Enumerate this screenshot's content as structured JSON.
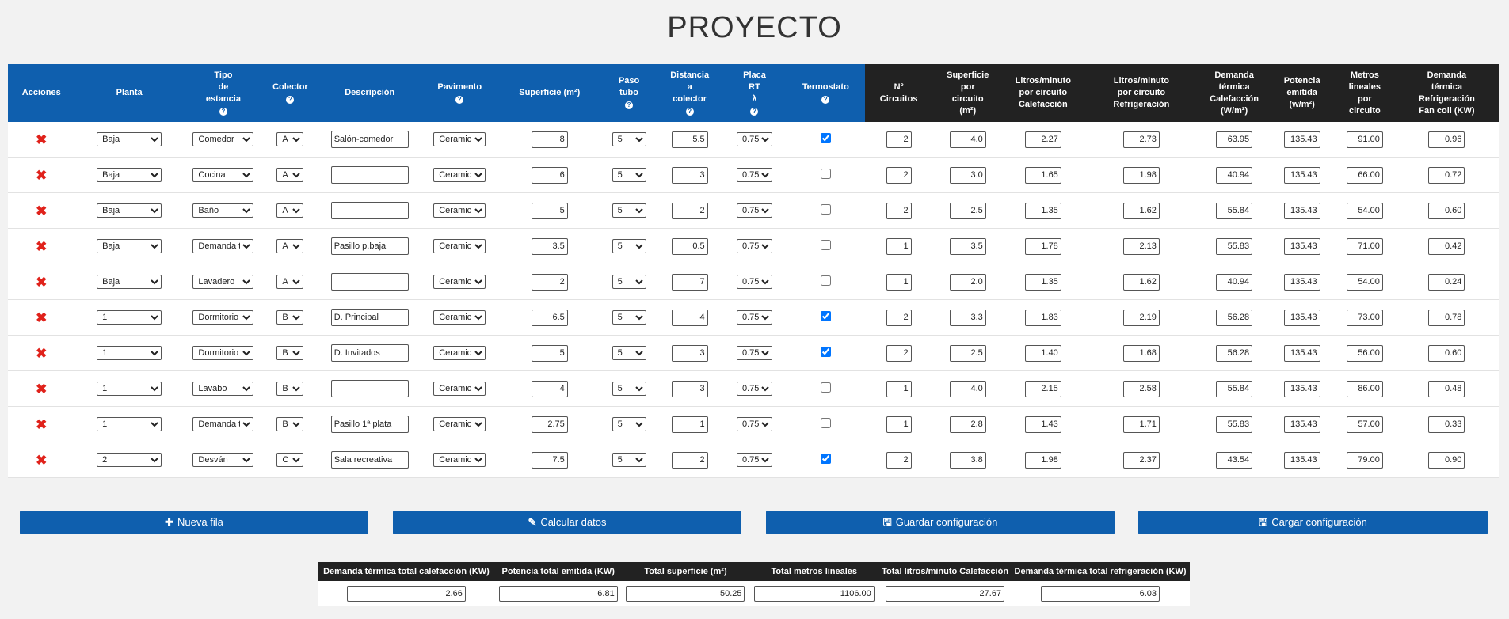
{
  "page_title": "PROYECTO",
  "headers": {
    "acciones": "Acciones",
    "planta": "Planta",
    "tipo_1": "Tipo",
    "tipo_2": "de",
    "tipo_3": "estancia",
    "colector": "Colector",
    "descripcion": "Descripción",
    "pavimento": "Pavimento",
    "superficie": "Superficie (m²)",
    "paso_1": "Paso",
    "paso_2": "tubo",
    "dist_1": "Distancia",
    "dist_2": "a",
    "dist_3": "colector",
    "placa_1": "Placa",
    "placa_2": "RT",
    "placa_3": "λ",
    "termostato": "Termostato",
    "nc_1": "Nº",
    "nc_2": "Circuitos",
    "spc_1": "Superficie",
    "spc_2": "por",
    "spc_3": "circuito",
    "spc_4": "(m²)",
    "lc_1": "Litros/minuto",
    "lc_2": "por circuito",
    "lc_3": "Calefacción",
    "lr_1": "Litros/minuto",
    "lr_2": "por circuito",
    "lr_3": "Refrigeración",
    "dc_1": "Demanda",
    "dc_2": "térmica",
    "dc_3": "Calefacción",
    "dc_4": "(W/m²)",
    "pe_1": "Potencia",
    "pe_2": "emitida",
    "pe_3": "(w/m²)",
    "ml_1": "Metros",
    "ml_2": "lineales",
    "ml_3": "por",
    "ml_4": "circuito",
    "dr_1": "Demanda",
    "dr_2": "térmica",
    "dr_3": "Refrigeración",
    "dr_4": "Fan coil (KW)",
    "help_glyph": "?"
  },
  "delete_glyph": "✖",
  "rows": [
    {
      "planta": "Baja",
      "tipo": "Comedor",
      "colector": "A",
      "descripcion": "Salón-comedor",
      "pavimento": "Ceramic",
      "superficie": "8",
      "paso": "5",
      "distancia": "5.5",
      "placa": "0.75",
      "termostato": true,
      "n_circuitos": "2",
      "sup_circuito": "4.0",
      "litros_cal": "2.27",
      "litros_ref": "2.73",
      "demanda_cal": "63.95",
      "potencia": "135.43",
      "metros": "91.00",
      "demanda_ref": "0.96"
    },
    {
      "planta": "Baja",
      "tipo": "Cocina",
      "colector": "A",
      "descripcion": "",
      "pavimento": "Ceramic",
      "superficie": "6",
      "paso": "5",
      "distancia": "3",
      "placa": "0.75",
      "termostato": false,
      "n_circuitos": "2",
      "sup_circuito": "3.0",
      "litros_cal": "1.65",
      "litros_ref": "1.98",
      "demanda_cal": "40.94",
      "potencia": "135.43",
      "metros": "66.00",
      "demanda_ref": "0.72"
    },
    {
      "planta": "Baja",
      "tipo": "Baño",
      "colector": "A",
      "descripcion": "",
      "pavimento": "Ceramic",
      "superficie": "5",
      "paso": "5",
      "distancia": "2",
      "placa": "0.75",
      "termostato": false,
      "n_circuitos": "2",
      "sup_circuito": "2.5",
      "litros_cal": "1.35",
      "litros_ref": "1.62",
      "demanda_cal": "55.84",
      "potencia": "135.43",
      "metros": "54.00",
      "demanda_ref": "0.60"
    },
    {
      "planta": "Baja",
      "tipo": "Demanda t",
      "colector": "A",
      "descripcion": "Pasillo p.baja",
      "pavimento": "Ceramic",
      "superficie": "3.5",
      "paso": "5",
      "distancia": "0.5",
      "placa": "0.75",
      "termostato": false,
      "n_circuitos": "1",
      "sup_circuito": "3.5",
      "litros_cal": "1.78",
      "litros_ref": "2.13",
      "demanda_cal": "55.83",
      "potencia": "135.43",
      "metros": "71.00",
      "demanda_ref": "0.42"
    },
    {
      "planta": "Baja",
      "tipo": "Lavadero",
      "colector": "A",
      "descripcion": "",
      "pavimento": "Ceramic",
      "superficie": "2",
      "paso": "5",
      "distancia": "7",
      "placa": "0.75",
      "termostato": false,
      "n_circuitos": "1",
      "sup_circuito": "2.0",
      "litros_cal": "1.35",
      "litros_ref": "1.62",
      "demanda_cal": "40.94",
      "potencia": "135.43",
      "metros": "54.00",
      "demanda_ref": "0.24"
    },
    {
      "planta": "1",
      "tipo": "Dormitorio",
      "colector": "B",
      "descripcion": "D. Principal",
      "pavimento": "Ceramic",
      "superficie": "6.5",
      "paso": "5",
      "distancia": "4",
      "placa": "0.75",
      "termostato": true,
      "n_circuitos": "2",
      "sup_circuito": "3.3",
      "litros_cal": "1.83",
      "litros_ref": "2.19",
      "demanda_cal": "56.28",
      "potencia": "135.43",
      "metros": "73.00",
      "demanda_ref": "0.78"
    },
    {
      "planta": "1",
      "tipo": "Dormitorio",
      "colector": "B",
      "descripcion": "D. Invitados",
      "pavimento": "Ceramic",
      "superficie": "5",
      "paso": "5",
      "distancia": "3",
      "placa": "0.75",
      "termostato": true,
      "n_circuitos": "2",
      "sup_circuito": "2.5",
      "litros_cal": "1.40",
      "litros_ref": "1.68",
      "demanda_cal": "56.28",
      "potencia": "135.43",
      "metros": "56.00",
      "demanda_ref": "0.60"
    },
    {
      "planta": "1",
      "tipo": "Lavabo",
      "colector": "B",
      "descripcion": "",
      "pavimento": "Ceramic",
      "superficie": "4",
      "paso": "5",
      "distancia": "3",
      "placa": "0.75",
      "termostato": false,
      "n_circuitos": "1",
      "sup_circuito": "4.0",
      "litros_cal": "2.15",
      "litros_ref": "2.58",
      "demanda_cal": "55.84",
      "potencia": "135.43",
      "metros": "86.00",
      "demanda_ref": "0.48"
    },
    {
      "planta": "1",
      "tipo": "Demanda t",
      "colector": "B",
      "descripcion": "Pasillo 1ª plata",
      "pavimento": "Ceramic",
      "superficie": "2.75",
      "paso": "5",
      "distancia": "1",
      "placa": "0.75",
      "termostato": false,
      "n_circuitos": "1",
      "sup_circuito": "2.8",
      "litros_cal": "1.43",
      "litros_ref": "1.71",
      "demanda_cal": "55.83",
      "potencia": "135.43",
      "metros": "57.00",
      "demanda_ref": "0.33"
    },
    {
      "planta": "2",
      "tipo": "Desván",
      "colector": "C",
      "descripcion": "Sala recreativa",
      "pavimento": "Ceramic",
      "superficie": "7.5",
      "paso": "5",
      "distancia": "2",
      "placa": "0.75",
      "termostato": true,
      "n_circuitos": "2",
      "sup_circuito": "3.8",
      "litros_cal": "1.98",
      "litros_ref": "2.37",
      "demanda_cal": "43.54",
      "potencia": "135.43",
      "metros": "79.00",
      "demanda_ref": "0.90"
    }
  ],
  "buttons": {
    "nueva_fila": {
      "icon": "✚",
      "label": "Nueva fila"
    },
    "calcular": {
      "icon": "✎",
      "label": "Calcular datos"
    },
    "guardar": {
      "icon": "🖫",
      "label": "Guardar configuración"
    },
    "cargar": {
      "icon": "🖫",
      "label": "Cargar configuración"
    }
  },
  "totals": {
    "headers": {
      "demanda_cal": "Demanda térmica total calefacción (KW)",
      "potencia": "Potencia total emitida (KW)",
      "superficie": "Total superficie (m²)",
      "metros": "Total metros lineales",
      "litros": "Total litros/minuto Calefacción",
      "demanda_ref": "Demanda térmica total refrigeración (KW)"
    },
    "values": {
      "demanda_cal": "2.66",
      "potencia": "6.81",
      "superficie": "50.25",
      "metros": "1106.00",
      "litros": "27.67",
      "demanda_ref": "6.03"
    }
  },
  "colors": {
    "header_blue": "#0f5fae",
    "header_dark": "#222222",
    "delete_red": "#e0221b",
    "button_blue": "#0f5fae"
  }
}
